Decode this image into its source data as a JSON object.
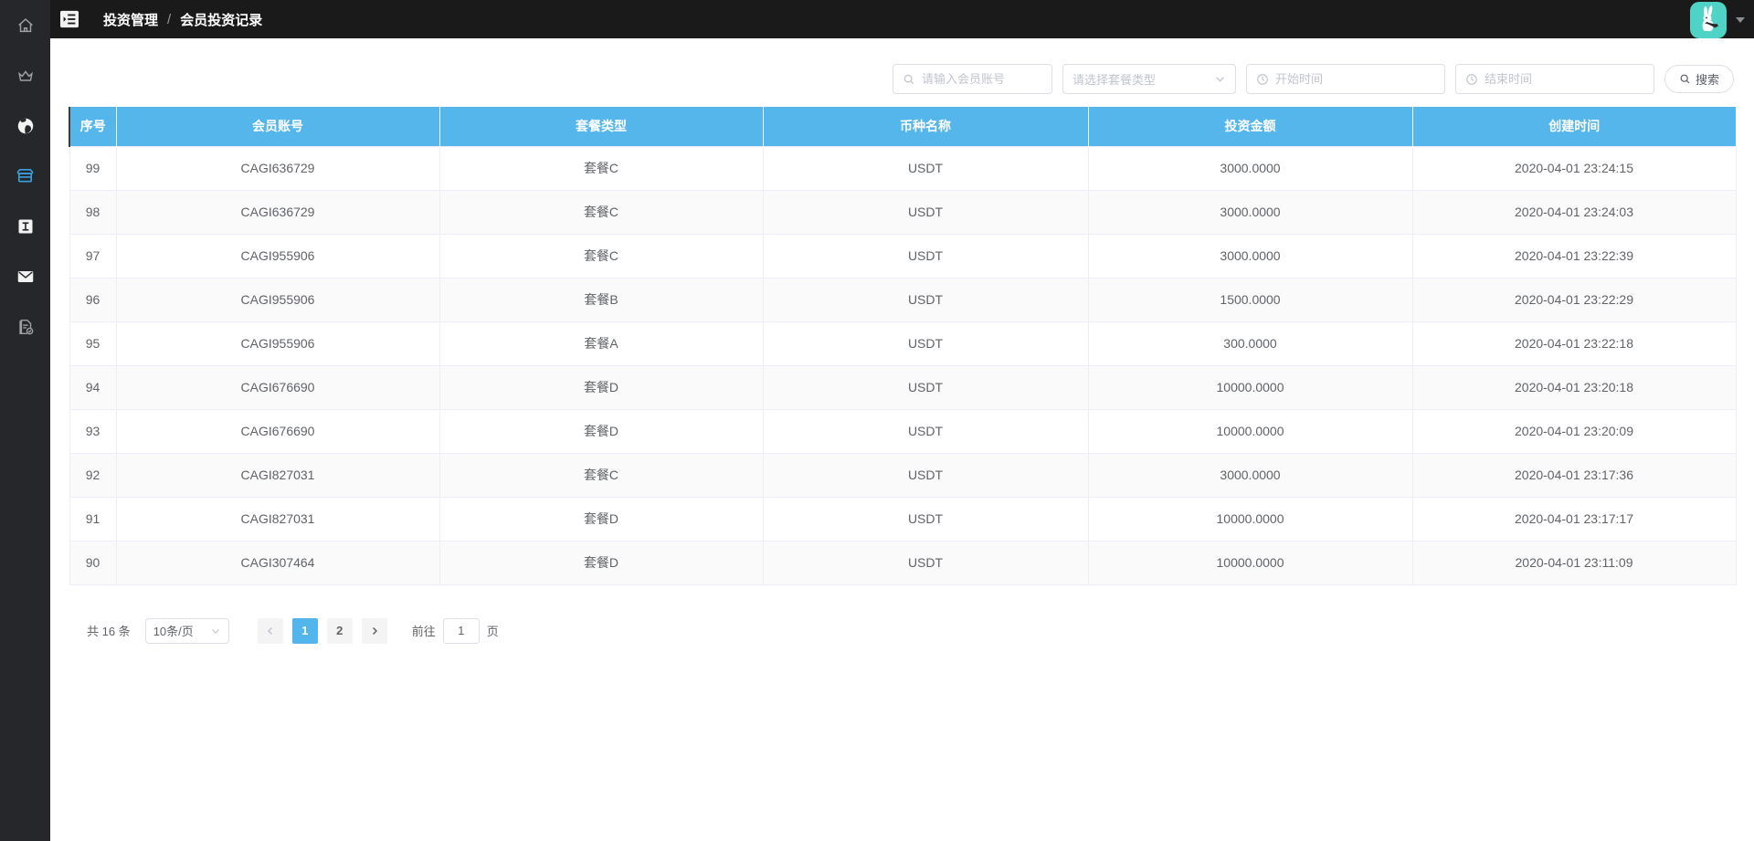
{
  "topbar": {
    "breadcrumb": {
      "section": "投资管理",
      "separator": "/",
      "page": "会员投资记录"
    }
  },
  "sidebar": {
    "items": [
      {
        "icon": "home-icon",
        "active": false
      },
      {
        "icon": "crown-icon",
        "active": false
      },
      {
        "icon": "globe-icon",
        "active": false
      },
      {
        "icon": "shop-icon",
        "active": true
      },
      {
        "icon": "info-box-icon",
        "active": false
      },
      {
        "icon": "mail-icon",
        "active": false
      },
      {
        "icon": "document-check-icon",
        "active": false
      }
    ]
  },
  "filters": {
    "account_placeholder": "请输入会员账号",
    "package_placeholder": "请选择套餐类型",
    "start_placeholder": "开始时间",
    "end_placeholder": "结束时间",
    "search_label": "搜索"
  },
  "table": {
    "columns": [
      "序号",
      "会员账号",
      "套餐类型",
      "币种名称",
      "投资金额",
      "创建时间"
    ],
    "rows": [
      {
        "seq": "99",
        "account": "CAGI636729",
        "package": "套餐C",
        "currency": "USDT",
        "amount": "3000.0000",
        "created": "2020-04-01 23:24:15"
      },
      {
        "seq": "98",
        "account": "CAGI636729",
        "package": "套餐C",
        "currency": "USDT",
        "amount": "3000.0000",
        "created": "2020-04-01 23:24:03"
      },
      {
        "seq": "97",
        "account": "CAGI955906",
        "package": "套餐C",
        "currency": "USDT",
        "amount": "3000.0000",
        "created": "2020-04-01 23:22:39"
      },
      {
        "seq": "96",
        "account": "CAGI955906",
        "package": "套餐B",
        "currency": "USDT",
        "amount": "1500.0000",
        "created": "2020-04-01 23:22:29"
      },
      {
        "seq": "95",
        "account": "CAGI955906",
        "package": "套餐A",
        "currency": "USDT",
        "amount": "300.0000",
        "created": "2020-04-01 23:22:18"
      },
      {
        "seq": "94",
        "account": "CAGI676690",
        "package": "套餐D",
        "currency": "USDT",
        "amount": "10000.0000",
        "created": "2020-04-01 23:20:18"
      },
      {
        "seq": "93",
        "account": "CAGI676690",
        "package": "套餐D",
        "currency": "USDT",
        "amount": "10000.0000",
        "created": "2020-04-01 23:20:09"
      },
      {
        "seq": "92",
        "account": "CAGI827031",
        "package": "套餐C",
        "currency": "USDT",
        "amount": "3000.0000",
        "created": "2020-04-01 23:17:36"
      },
      {
        "seq": "91",
        "account": "CAGI827031",
        "package": "套餐D",
        "currency": "USDT",
        "amount": "10000.0000",
        "created": "2020-04-01 23:17:17"
      },
      {
        "seq": "90",
        "account": "CAGI307464",
        "package": "套餐D",
        "currency": "USDT",
        "amount": "10000.0000",
        "created": "2020-04-01 23:11:09"
      }
    ]
  },
  "pagination": {
    "total_label": "共 16 条",
    "page_size_label": "10条/页",
    "pages": [
      "1",
      "2"
    ],
    "active_page": "1",
    "goto_label": "前往",
    "goto_value": "1",
    "goto_suffix": "页"
  },
  "colors": {
    "table_header_blue": "#55b6ec",
    "active_page_blue": "#52b5ec",
    "sidebar_bg": "#26272b",
    "topbar_bg": "#1a1a1a",
    "active_icon_blue": "#3aa1e0",
    "avatar_teal": "#4ed3c6",
    "row_stripe": "#fafafa",
    "border_gray": "#ebeef5"
  }
}
